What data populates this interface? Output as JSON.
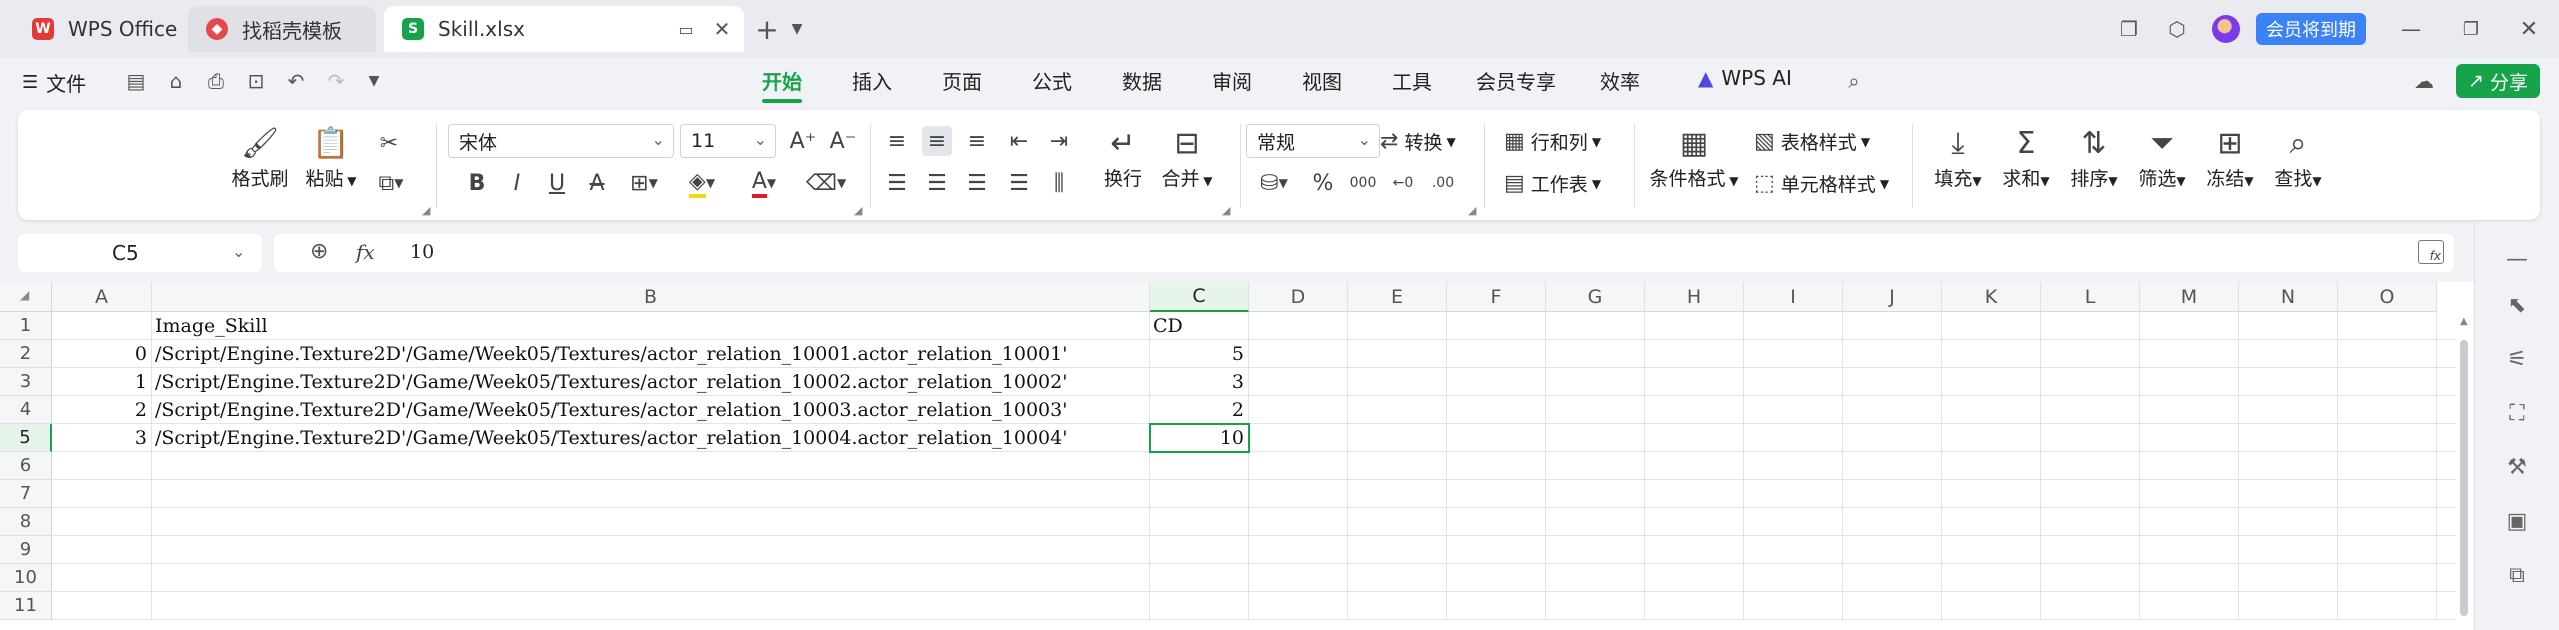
{
  "tabs": [
    {
      "label": "WPS Office",
      "icon": "wps-logo-icon"
    },
    {
      "label": "找稻壳模板",
      "icon": "docer-icon"
    },
    {
      "label": "Skill.xlsx",
      "icon": "spreadsheet-icon",
      "active": true
    }
  ],
  "titlebar": {
    "member_label": "会员将到期"
  },
  "menubar": {
    "file_label": "文件",
    "items": [
      "开始",
      "插入",
      "页面",
      "公式",
      "数据",
      "审阅",
      "视图",
      "工具",
      "会员专享",
      "效率"
    ],
    "ai_label": "WPS AI",
    "share_label": "分享"
  },
  "ribbon": {
    "format_painter": "格式刷",
    "paste": "粘贴",
    "font_name": "宋体",
    "font_size": "11",
    "wrap": "换行",
    "merge": "合并",
    "number_format": "常规",
    "convert": "转换",
    "rows_cols": "行和列",
    "worksheet": "工作表",
    "cond_format": "条件格式",
    "table_style": "表格样式",
    "cell_style": "单元格样式",
    "fill": "填充",
    "sum": "求和",
    "sort": "排序",
    "filter": "筛选",
    "freeze": "冻结",
    "find": "查找"
  },
  "formula": {
    "cell_ref": "C5",
    "fx": "fx",
    "value": "10"
  },
  "sheet": {
    "columns": [
      "A",
      "B",
      "C",
      "D",
      "E",
      "F",
      "G",
      "H",
      "I",
      "J",
      "K",
      "L",
      "M",
      "N",
      "O"
    ],
    "rows": [
      "1",
      "2",
      "3",
      "4",
      "5",
      "6",
      "7",
      "8",
      "9",
      "10",
      "11"
    ],
    "cells": {
      "B1": "Image_Skill",
      "C1": "CD",
      "A2": "0",
      "B2": "/Script/Engine.Texture2D'/Game/Week05/Textures/actor_relation_10001.actor_relation_10001'",
      "C2": "5",
      "A3": "1",
      "B3": "/Script/Engine.Texture2D'/Game/Week05/Textures/actor_relation_10002.actor_relation_10002'",
      "C3": "3",
      "A4": "2",
      "B4": "/Script/Engine.Texture2D'/Game/Week05/Textures/actor_relation_10003.actor_relation_10003'",
      "C4": "2",
      "A5": "3",
      "B5": "/Script/Engine.Texture2D'/Game/Week05/Textures/actor_relation_10004.actor_relation_10004'",
      "C5": "10"
    }
  },
  "colors": {
    "accent": "#17a34a",
    "member_badge": "#3b82f6"
  }
}
